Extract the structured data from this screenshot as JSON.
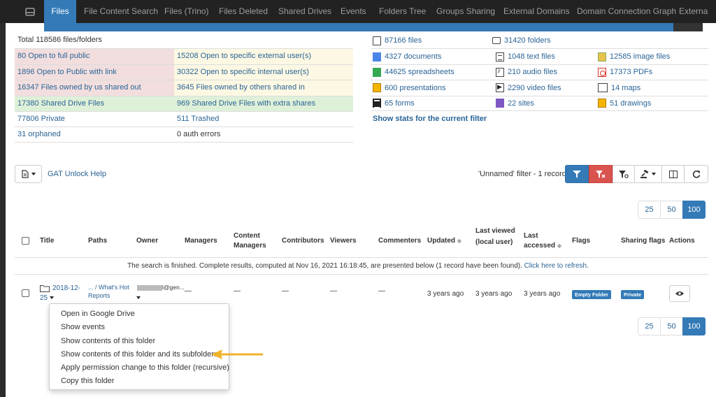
{
  "nav": {
    "tabs": [
      "Files",
      "File Content Search",
      "Files (Trino)",
      "Files Deleted",
      "Shared Drives",
      "Events",
      "Folders Tree",
      "Groups Sharing",
      "External Domains",
      "Domain Connection Graph",
      "Externa"
    ]
  },
  "stats": {
    "total": "Total 118586 files/folders",
    "left": [
      [
        "80 Open to full public",
        "15208 Open to specific external user(s)"
      ],
      [
        "1896 Open to Public with link",
        "30322 Open to specific internal user(s)"
      ],
      [
        "16347 Files owned by us shared out",
        "3645 Files owned by others shared in"
      ],
      [
        "17380 Shared Drive Files",
        "969 Shared Drive Files with extra shares"
      ],
      [
        "77806 Private",
        "511 Trashed"
      ],
      [
        "31 orphaned",
        "0 auth errors"
      ]
    ],
    "right": [
      [
        "87166 files",
        "31420 folders",
        ""
      ],
      [
        "4327 documents",
        "1048 text files",
        "12585 image files"
      ],
      [
        "44625 spreadsheets",
        "210 audio files",
        "17373 PDFs"
      ],
      [
        "600 presentations",
        "2290 video files",
        "14 maps"
      ],
      [
        "65 forms",
        "22 sites",
        "51 drawings"
      ]
    ],
    "filter_link": "Show stats for the current filter"
  },
  "toolbar": {
    "help": "GAT Unlock Help",
    "filter_info": "'Unnamed' filter -  1 record"
  },
  "pager": [
    "25",
    "50",
    "100"
  ],
  "grid": {
    "headers": {
      "title": "Title",
      "paths": "Paths",
      "owner": "Owner",
      "managers": "Managers",
      "content_managers_1": "Content",
      "content_managers_2": "Managers",
      "contributors": "Contributors",
      "viewers": "Viewers",
      "commenters": "Commenters",
      "updated": "Updated",
      "last_viewed_1": "Last viewed",
      "last_viewed_2": "(local user)",
      "last_accessed_1": "Last",
      "last_accessed_2": "accessed",
      "flags": "Flags",
      "sharing_flags": "Sharing flags",
      "actions": "Actions"
    },
    "notice": "The search is finished. Complete results, computed at Nov 16, 2021 16:18:45, are presented below (1 record have been found).",
    "refresh": "Click here to refresh.",
    "row": {
      "title_1": "2018-12-",
      "title_2": "25",
      "path_1": "... / What's Hot",
      "path_2": "Reports",
      "owner": "l@gen...",
      "managers": "—",
      "content_managers": "—",
      "contributors": "—",
      "viewers": "—",
      "commenters": "—",
      "updated": "3 years ago",
      "last_viewed": "3 years ago",
      "last_accessed": "3 years ago",
      "flag": "Empty Folder",
      "sharing_flag": "Private"
    }
  },
  "menu": [
    "Open in Google Drive",
    "Show events",
    "Show contents of this folder",
    "Show contents of this folder and its subfolders",
    "Apply permission change to this folder (recursive)",
    "Copy this folder"
  ],
  "colors": {
    "nav_bg": "#222222",
    "accent": "#337ab7",
    "danger": "#d9534f",
    "row_red": "#f2dede",
    "row_yellow": "#fcf8e3",
    "row_green": "#dff0d8",
    "arrow": "#f0b429"
  }
}
